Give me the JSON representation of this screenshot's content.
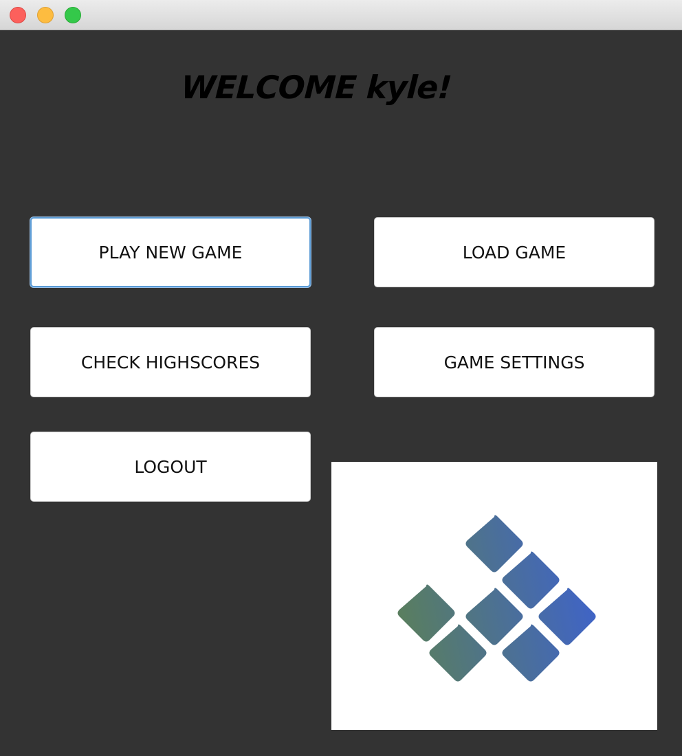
{
  "window": {
    "controls": [
      "close",
      "minimize",
      "zoom"
    ]
  },
  "header": {
    "welcome_text": "WELCOME kyle!"
  },
  "menu": {
    "play_new_game": "PLAY NEW GAME",
    "load_game": "LOAD GAME",
    "check_highscores": "CHECK HIGHSCORES",
    "game_settings": "GAME SETTINGS",
    "logout": "LOGOUT"
  },
  "logo": {
    "icon": "tile-diamonds-logo",
    "gradient_start": "#5a7f5c",
    "gradient_end": "#3f63c9"
  },
  "colors": {
    "background": "#333333",
    "button_bg": "#ffffff",
    "focus_ring": "#5b9bd5"
  }
}
